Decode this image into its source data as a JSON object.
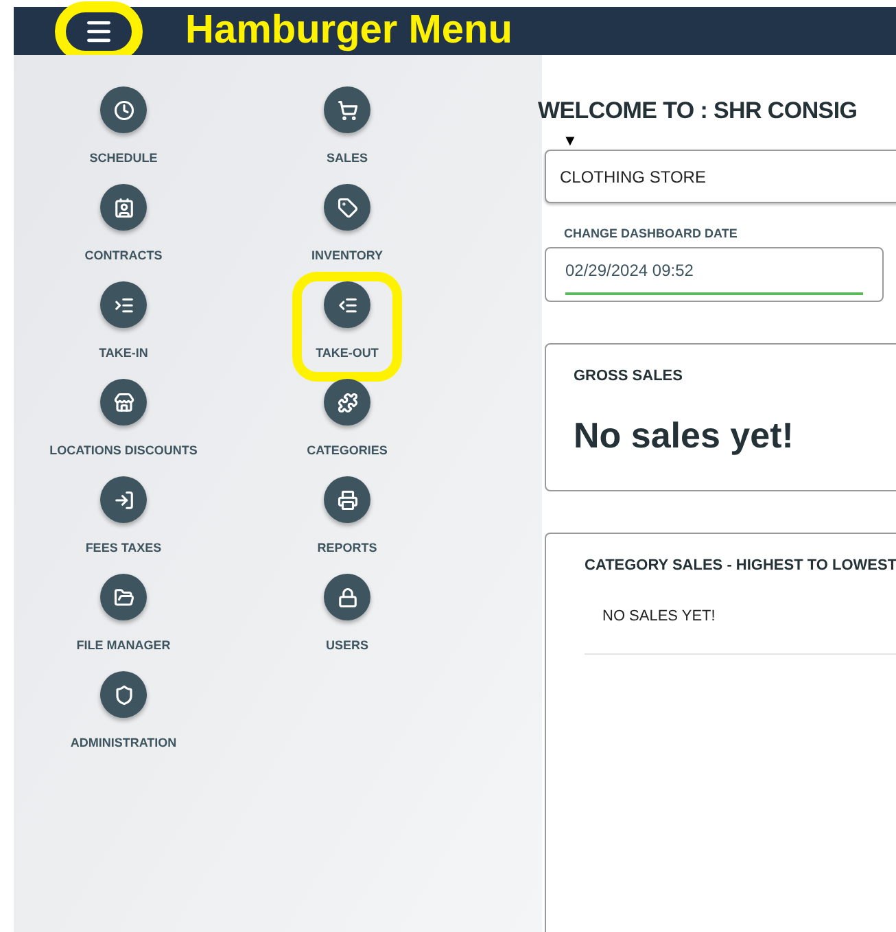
{
  "header": {
    "menu_button": {
      "annotated": true
    },
    "annotation_title": "Hamburger Menu"
  },
  "menu": [
    {
      "label": "SCHEDULE",
      "annotated": false
    },
    {
      "label": "SALES",
      "annotated": false
    },
    {
      "label": "CONTRACTS",
      "annotated": false
    },
    {
      "label": "INVENTORY",
      "annotated": false
    },
    {
      "label": "TAKE-IN",
      "annotated": false
    },
    {
      "label": "TAKE-OUT",
      "annotated": true
    },
    {
      "label": "LOCATIONS DISCOUNTS",
      "annotated": false
    },
    {
      "label": "CATEGORIES",
      "annotated": false
    },
    {
      "label": "FEES TAXES",
      "annotated": false
    },
    {
      "label": "REPORTS",
      "annotated": false
    },
    {
      "label": "FILE MANAGER",
      "annotated": false
    },
    {
      "label": "USERS",
      "annotated": false
    },
    {
      "label": "ADMINISTRATION",
      "annotated": false
    }
  ],
  "main": {
    "title": "WELCOME TO : SHR CONSIG",
    "store_select": {
      "arrow": "▼",
      "value": "CLOTHING STORE"
    },
    "date_field": {
      "label": "CHANGE DASHBOARD DATE",
      "value": "02/29/2024 09:52"
    },
    "gross_sales": {
      "title": "GROSS SALES",
      "value": "No sales yet!"
    },
    "category_sales": {
      "title": "CATEGORY SALES - HIGHEST TO LOWEST",
      "rows": [
        "NO SALES YET!"
      ]
    }
  }
}
